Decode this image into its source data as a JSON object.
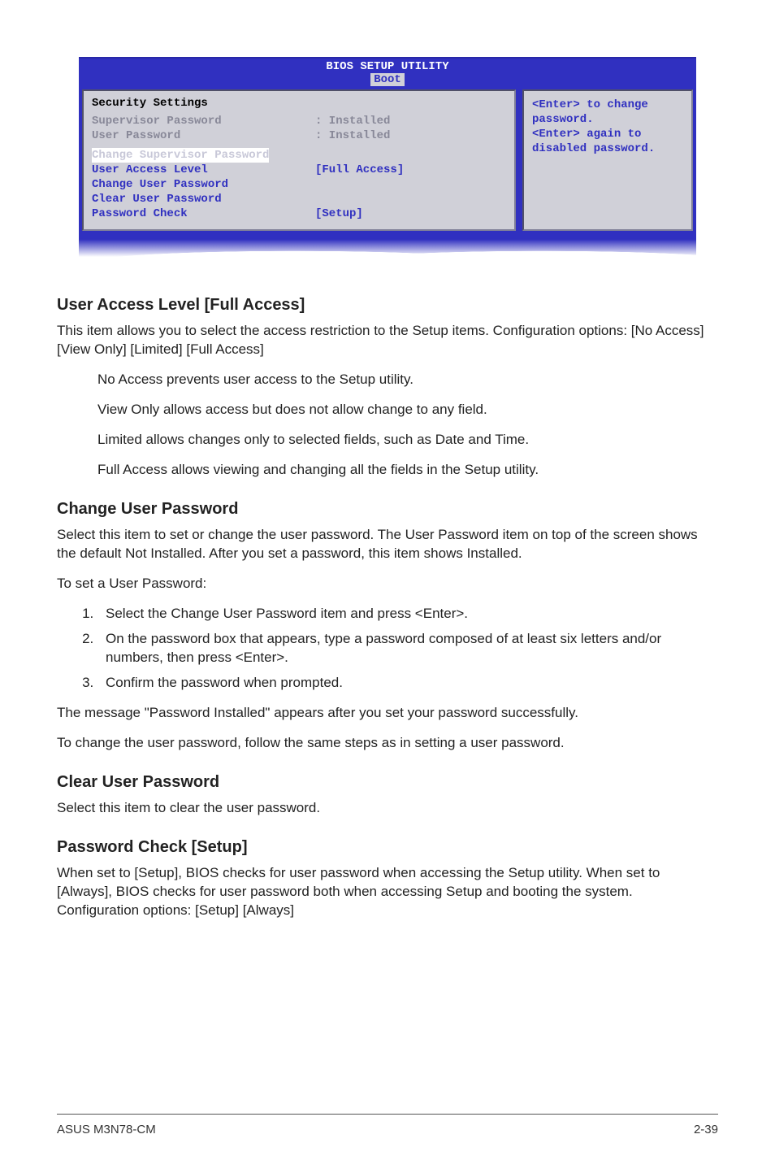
{
  "bios": {
    "title": "BIOS SETUP UTILITY",
    "tab": "Boot",
    "heading": "Security Settings",
    "sup_label": "Supervisor Password",
    "sup_value": ": Installed",
    "usr_label": "User Password",
    "usr_value": ": Installed",
    "change_sup": "Change Supervisor Password",
    "ual_label": "User Access Level",
    "ual_value": "[Full Access]",
    "change_usr": "Change User Password",
    "clear_usr": "Clear User Password",
    "pc_label": "Password Check",
    "pc_value": "[Setup]",
    "help": "<Enter> to change password.\n<Enter> again to disabled password."
  },
  "s1": {
    "title": "User Access Level [Full Access]",
    "p1": "This item allows you to select the access restriction to the Setup items. Configuration options: [No Access] [View Only] [Limited] [Full Access]",
    "li1": "No Access prevents user access to the Setup utility.",
    "li2": "View Only allows access but does not allow change to any field.",
    "li3": "Limited allows changes only to selected fields, such as Date and Time.",
    "li4": "Full Access allows viewing and changing all the fields in the Setup utility."
  },
  "s2": {
    "title": "Change User Password",
    "p1": "Select this item to set or change the user password. The User Password item on top of the screen shows the default Not Installed. After you set a password, this item shows Installed.",
    "p2": "To set a User Password:",
    "ol1": "Select the Change User Password item and press <Enter>.",
    "ol2": "On the password box that appears, type a password composed of at least six letters and/or numbers, then press <Enter>.",
    "ol3": "Confirm the password when prompted.",
    "p3": "The message \"Password Installed\" appears after you set your password successfully.",
    "p4": "To change the user password, follow the same steps as in setting a user password."
  },
  "s3": {
    "title": "Clear User Password",
    "p1": "Select this item to clear the user password."
  },
  "s4": {
    "title": "Password Check [Setup]",
    "p1": "When set to [Setup], BIOS checks for user password when accessing the Setup utility. When set to [Always], BIOS checks for user password both when accessing Setup and booting the system. Configuration options: [Setup] [Always]"
  },
  "footer": {
    "left": "ASUS M3N78-CM",
    "right": "2-39"
  }
}
